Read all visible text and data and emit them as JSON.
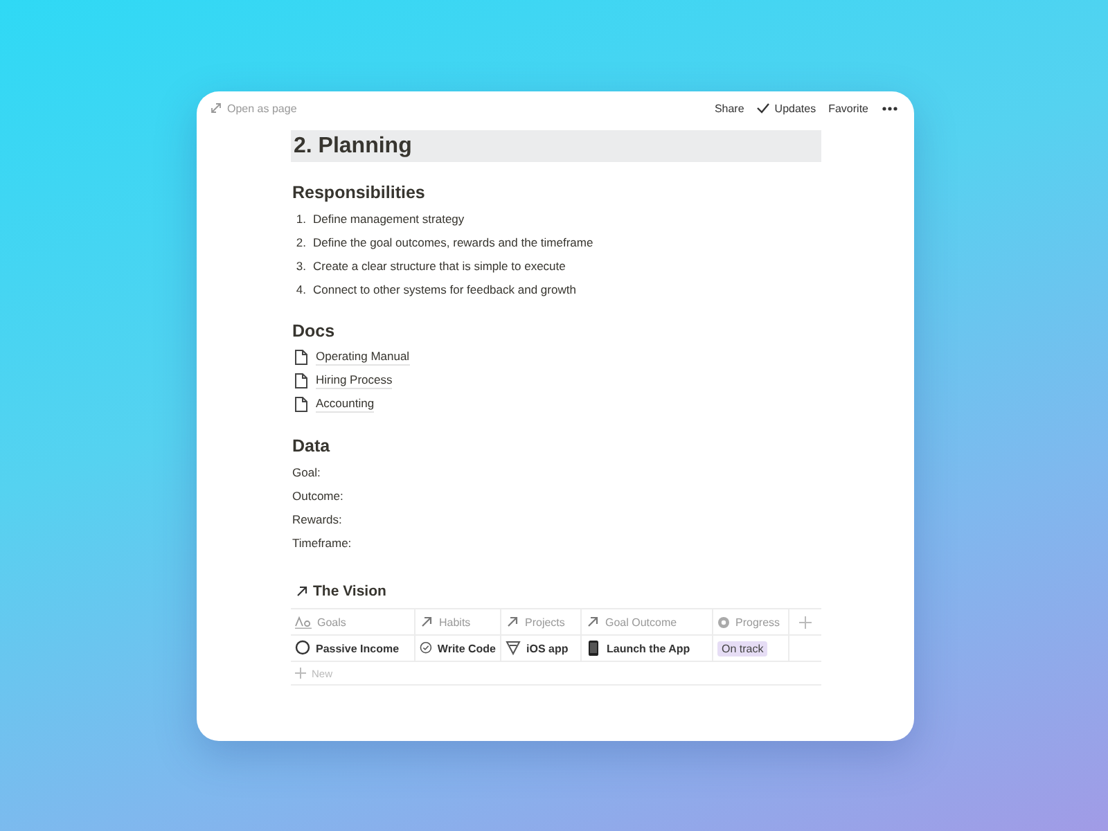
{
  "topbar": {
    "open_as_page": "Open as page",
    "actions": [
      {
        "label": "Share",
        "checked": false
      },
      {
        "label": "Updates",
        "checked": true
      },
      {
        "label": "Favorite",
        "checked": false
      }
    ]
  },
  "title": {
    "text": "2. Planning",
    "highlighted": true
  },
  "sections": [
    {
      "heading": "Responsibilities",
      "kind": "numbered",
      "items": [
        {
          "number": "1.",
          "text": "Define management strategy"
        },
        {
          "number": "2.",
          "text": "Define the goal outcomes, rewards and the timeframe"
        },
        {
          "number": "3.",
          "text": "Create a clear structure that is simple to execute"
        },
        {
          "number": "4.",
          "text": "Connect to other systems for feedback and growth"
        }
      ]
    },
    {
      "heading": "Docs",
      "kind": "pages",
      "items": [
        {
          "text": "Operating Manual"
        },
        {
          "text": "Hiring Process"
        },
        {
          "text": "Accounting"
        }
      ]
    },
    {
      "heading": "Data",
      "kind": "fields",
      "items": [
        {
          "text": "Goal:"
        },
        {
          "text": "Outcome:"
        },
        {
          "text": "Rewards:"
        },
        {
          "text": "Timeframe:"
        }
      ]
    }
  ],
  "database": {
    "title": "The Vision",
    "columns": [
      {
        "label": "Goals",
        "kind": "title"
      },
      {
        "label": "Habits",
        "kind": "relation"
      },
      {
        "label": "Projects",
        "kind": "relation"
      },
      {
        "label": "Goal Outcome",
        "kind": "relation"
      },
      {
        "label": "Progress",
        "kind": "status"
      }
    ],
    "rows": [
      {
        "cells": [
          {
            "text": "Passive Income",
            "kind": "goal"
          },
          {
            "text": "Write Code",
            "kind": "habit"
          },
          {
            "text": "iOS app",
            "kind": "project"
          },
          {
            "text": "Launch the App",
            "kind": "outcome"
          },
          {
            "text": "On track",
            "kind": "status",
            "color": "#e6ddf5"
          }
        ]
      }
    ],
    "new_row": "New"
  }
}
